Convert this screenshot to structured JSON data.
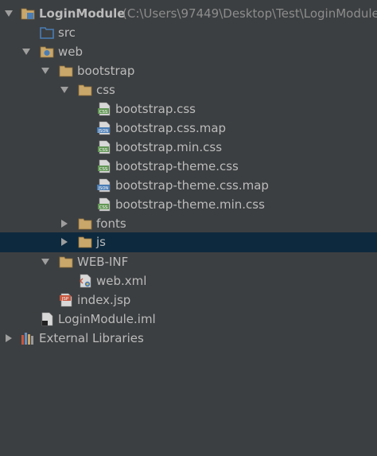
{
  "colors": {
    "background": "#3c3f41",
    "selection": "#0d293e",
    "text": "#bbbbbb",
    "hint_text": "#8c8c8c",
    "folder_fill": "#c9a76b",
    "css_icon": "#629755",
    "json_icon": "#4a7db5",
    "jsp_icon": "#c7573f"
  },
  "tree": {
    "root": {
      "label": "LoginModule",
      "path_hint": "(C:\\Users\\97449\\Desktop\\Test\\LoginModule",
      "icon": "module-folder-icon",
      "expanded": true
    },
    "src": {
      "label": "src",
      "icon": "source-folder-icon"
    },
    "web": {
      "label": "web",
      "icon": "web-folder-icon",
      "expanded": true
    },
    "bootstrap": {
      "label": "bootstrap",
      "icon": "folder-icon",
      "expanded": true
    },
    "css": {
      "label": "css",
      "icon": "folder-icon",
      "expanded": true
    },
    "css_files": [
      {
        "label": "bootstrap.css",
        "icon": "css-file-icon",
        "badge": "CSS"
      },
      {
        "label": "bootstrap.css.map",
        "icon": "json-file-icon",
        "badge": "JSON"
      },
      {
        "label": "bootstrap.min.css",
        "icon": "css-file-icon",
        "badge": "CSS"
      },
      {
        "label": "bootstrap-theme.css",
        "icon": "css-file-icon",
        "badge": "CSS"
      },
      {
        "label": "bootstrap-theme.css.map",
        "icon": "json-file-icon",
        "badge": "JSON"
      },
      {
        "label": "bootstrap-theme.min.css",
        "icon": "css-file-icon",
        "badge": "CSS"
      }
    ],
    "fonts": {
      "label": "fonts",
      "icon": "folder-icon",
      "expanded": false
    },
    "js": {
      "label": "js",
      "icon": "folder-icon",
      "expanded": false,
      "selected": true
    },
    "webinf": {
      "label": "WEB-INF",
      "icon": "folder-icon",
      "expanded": true
    },
    "webxml": {
      "label": "web.xml",
      "icon": "xml-file-icon"
    },
    "indexjsp": {
      "label": "index.jsp",
      "icon": "jsp-file-icon",
      "badge": "JSP"
    },
    "iml": {
      "label": "LoginModule.iml",
      "icon": "iml-file-icon"
    },
    "libraries": {
      "label": "External Libraries",
      "icon": "libraries-icon",
      "expanded": false
    }
  }
}
